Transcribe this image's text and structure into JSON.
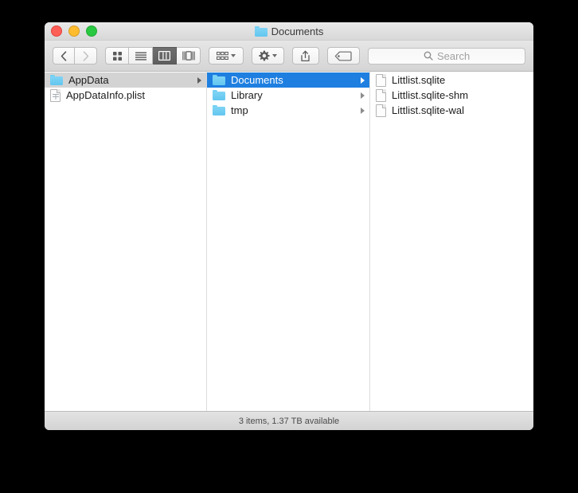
{
  "window": {
    "title": "Documents",
    "title_icon": "folder-icon",
    "traffic_lights": [
      {
        "name": "close-button",
        "color": "#ff5f57"
      },
      {
        "name": "minimize-button",
        "color": "#febc2e"
      },
      {
        "name": "zoom-button",
        "color": "#28c840"
      }
    ]
  },
  "toolbar": {
    "back_icon": "chevron-left-icon",
    "forward_icon": "chevron-right-icon",
    "view_modes": [
      {
        "name": "icon-view",
        "icon": "grid-icon",
        "active": false
      },
      {
        "name": "list-view",
        "icon": "list-lines-icon",
        "active": false
      },
      {
        "name": "column-view",
        "icon": "columns-icon",
        "active": true
      },
      {
        "name": "gallery-view",
        "icon": "gallery-icon",
        "active": false
      }
    ],
    "arrange_icon": "arrange-grid-icon",
    "arrange_chevron": "chevron-down-icon",
    "action_icon": "gear-icon",
    "action_chevron": "chevron-down-icon",
    "share_icon": "share-icon",
    "tag_icon": "tag-icon"
  },
  "search": {
    "icon": "search-icon",
    "placeholder": "Search",
    "value": ""
  },
  "columns": [
    {
      "name": "column-1",
      "items": [
        {
          "label": "AppData",
          "icon": "folder-icon",
          "selected": "inactive",
          "has_children": true
        },
        {
          "label": "AppDataInfo.plist",
          "icon": "plist-file-icon",
          "selected": "none",
          "has_children": false
        }
      ]
    },
    {
      "name": "column-2",
      "items": [
        {
          "label": "Documents",
          "icon": "folder-icon",
          "selected": "active",
          "has_children": true
        },
        {
          "label": "Library",
          "icon": "folder-icon",
          "selected": "none",
          "has_children": true
        },
        {
          "label": "tmp",
          "icon": "folder-icon",
          "selected": "none",
          "has_children": true
        }
      ]
    },
    {
      "name": "column-3",
      "items": [
        {
          "label": "Littlist.sqlite",
          "icon": "document-icon",
          "selected": "none",
          "has_children": false
        },
        {
          "label": "Littlist.sqlite-shm",
          "icon": "document-icon",
          "selected": "none",
          "has_children": false
        },
        {
          "label": "Littlist.sqlite-wal",
          "icon": "document-icon",
          "selected": "none",
          "has_children": false
        }
      ]
    }
  ],
  "statusbar": {
    "text": "3 items, 1.37 TB available"
  },
  "colors": {
    "selection_active": "#1e7fe0",
    "selection_inactive": "#d3d3d3",
    "folder_blue": "#62c6ef",
    "desktop": "#000000"
  }
}
